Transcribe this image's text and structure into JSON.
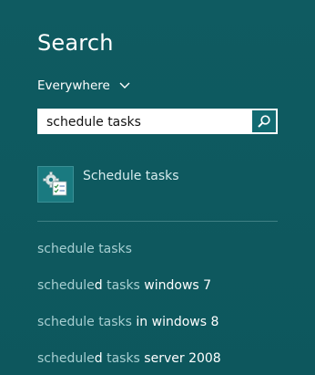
{
  "search": {
    "title": "Search",
    "scope_label": "Everywhere",
    "query": "schedule tasks"
  },
  "icons": {
    "scope_dropdown": "chevron-down-icon",
    "search_button": "magnifier-icon",
    "app_icon": "schedule-tasks-icon"
  },
  "results": {
    "app": {
      "label": "Schedule tasks"
    },
    "suggestions": [
      {
        "parts": [
          "schedule tasks",
          ""
        ]
      },
      {
        "parts": [
          "schedule",
          "d",
          " tasks",
          " windows 7"
        ]
      },
      {
        "parts": [
          "schedule tasks",
          " in windows 8"
        ]
      },
      {
        "parts": [
          "schedule",
          "d",
          " tasks",
          " server 2008"
        ]
      }
    ]
  },
  "colors": {
    "background": "#0e5a60",
    "search_button": "#126b72",
    "suggestion_dim": "#a7cfd2",
    "suggestion_bright": "#ffffff"
  }
}
